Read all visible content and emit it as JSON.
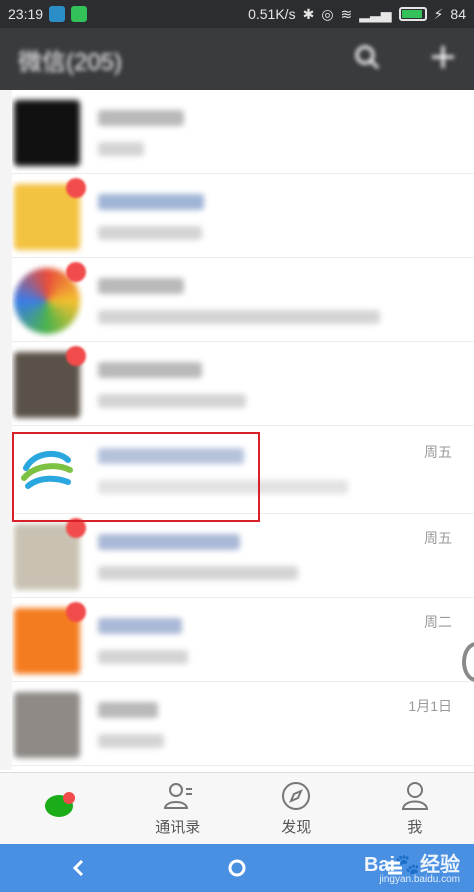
{
  "status_bar": {
    "time": "23:19",
    "net_speed": "0.51K/s",
    "battery": "84"
  },
  "titlebar": {
    "title": "微信(205)",
    "search_icon": "search-icon",
    "add_icon": "plus-icon"
  },
  "chats": [
    {
      "time": ""
    },
    {
      "time": ""
    },
    {
      "time": ""
    },
    {
      "time": ""
    },
    {
      "time": "周五"
    },
    {
      "time": "周五"
    },
    {
      "time": "周二"
    },
    {
      "time": "1月1日"
    }
  ],
  "tabs": [
    {
      "label": "",
      "icon": "chat-bubble-icon"
    },
    {
      "label": "通讯录",
      "icon": "contacts-icon"
    },
    {
      "label": "发现",
      "icon": "compass-icon"
    },
    {
      "label": "我",
      "icon": "person-icon"
    }
  ],
  "colors": {
    "highlight": "#d8202a",
    "wechat_green": "#1aad19",
    "badge_red": "#f24b4b",
    "nav_blue": "#4a90e2"
  }
}
